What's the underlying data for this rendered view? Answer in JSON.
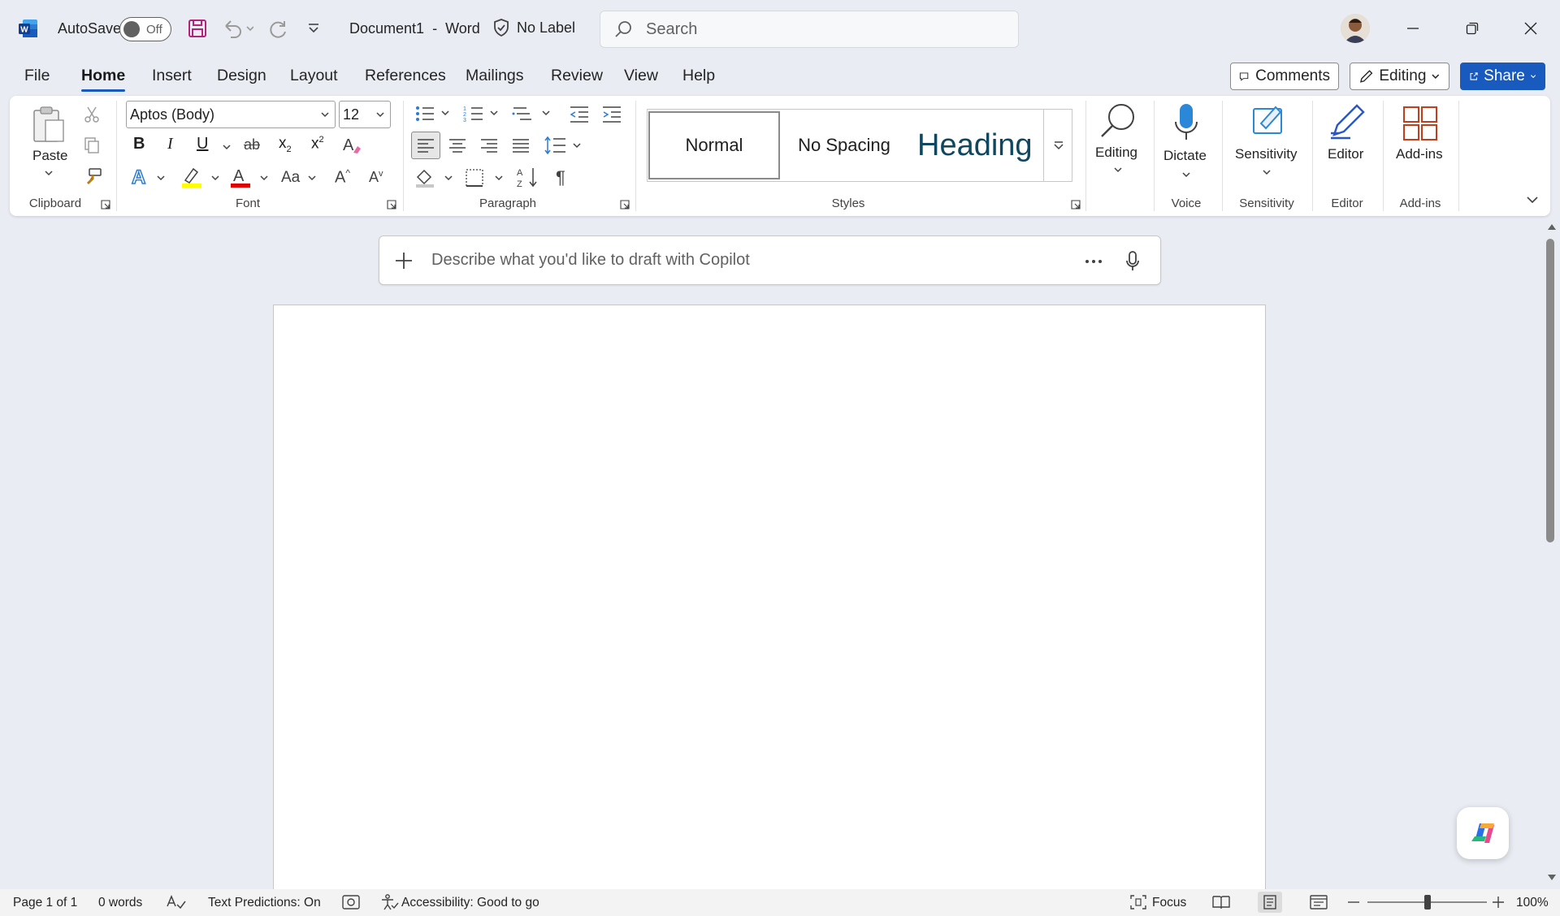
{
  "titlebar": {
    "autosave_label": "AutoSave",
    "autosave_state": "Off",
    "doc_title": "Document1",
    "title_sep": "-",
    "app_name": "Word",
    "sensitivity_label": "No Label",
    "search_placeholder": "Search"
  },
  "tabs": [
    "File",
    "Home",
    "Insert",
    "Design",
    "Layout",
    "References",
    "Mailings",
    "Review",
    "View",
    "Help"
  ],
  "active_tab": "Home",
  "actions": {
    "comments": "Comments",
    "editing": "Editing",
    "share": "Share"
  },
  "ribbon": {
    "clipboard": {
      "label": "Clipboard",
      "paste": "Paste"
    },
    "font": {
      "label": "Font",
      "family": "Aptos (Body)",
      "size": "12"
    },
    "paragraph": {
      "label": "Paragraph"
    },
    "styles": {
      "label": "Styles",
      "items": [
        "Normal",
        "No Spacing",
        "Heading"
      ]
    },
    "editing": {
      "label": "Editing"
    },
    "voice": {
      "label": "Voice",
      "dictate": "Dictate"
    },
    "sensitivity": {
      "label": "Sensitivity",
      "button": "Sensitivity"
    },
    "editor": {
      "label": "Editor",
      "button": "Editor"
    },
    "addins": {
      "label": "Add-ins",
      "button": "Add-ins"
    }
  },
  "copilot": {
    "placeholder": "Describe what you'd like to draft with Copilot"
  },
  "status": {
    "page": "Page 1 of 1",
    "words": "0 words",
    "text_predictions": "Text Predictions: On",
    "accessibility": "Accessibility: Good to go",
    "focus": "Focus",
    "zoom": "100%",
    "zoom_fraction": 0.5
  },
  "colors": {
    "accent": "#185abd",
    "word_blue": "#2b579a",
    "save_purple": "#a4262c"
  }
}
